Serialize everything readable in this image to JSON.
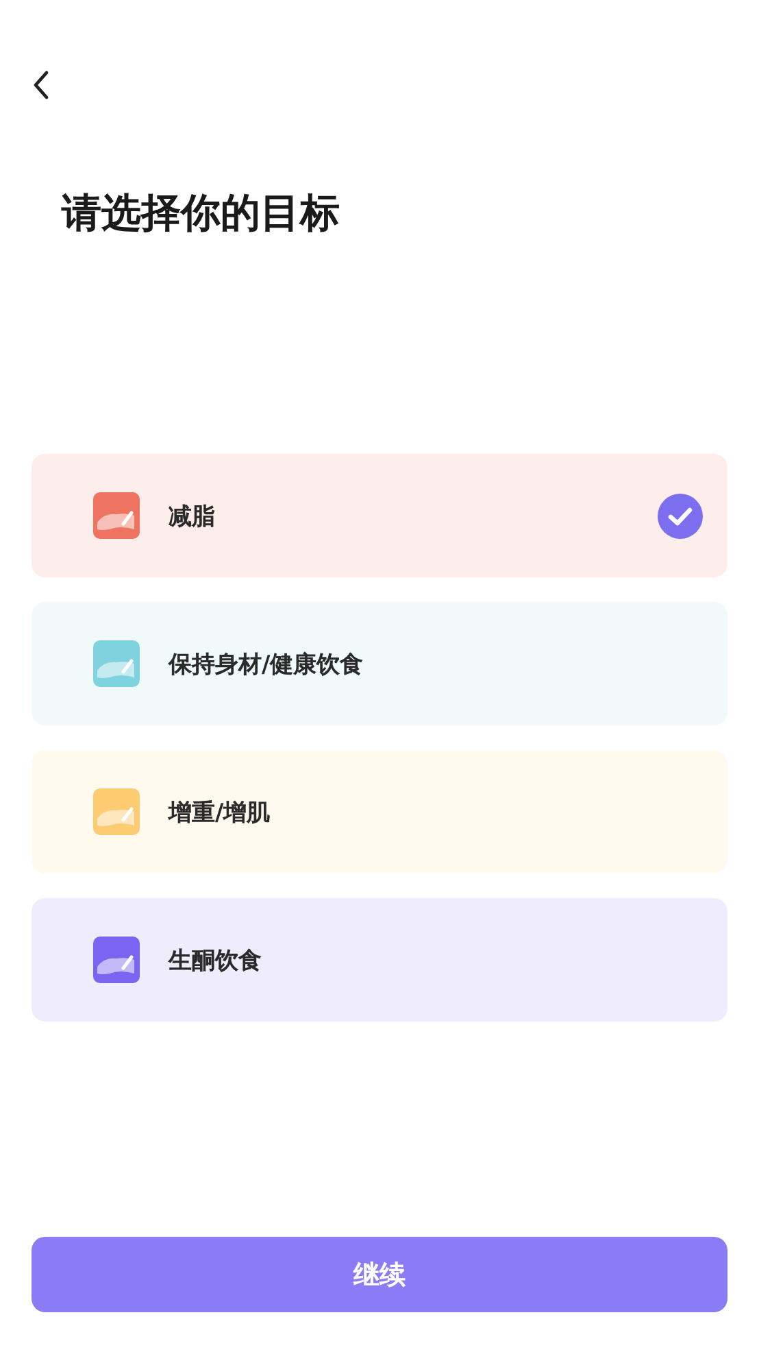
{
  "title": "请选择你的目标",
  "options": [
    {
      "label": "减脂",
      "color": "#ee7461",
      "selected": true
    },
    {
      "label": "保持身材/健康饮食",
      "color": "#7fd3de",
      "selected": false
    },
    {
      "label": "增重/增肌",
      "color": "#fdcb72",
      "selected": false
    },
    {
      "label": "生酮饮食",
      "color": "#7a64f0",
      "selected": false
    }
  ],
  "continue_button": "继续"
}
